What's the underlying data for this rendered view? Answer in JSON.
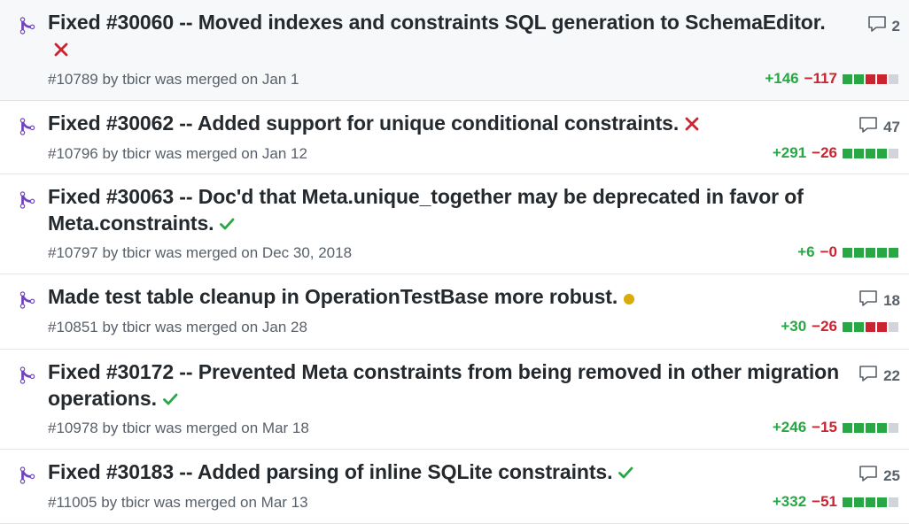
{
  "colors": {
    "added": "#28a745",
    "deleted": "#cb2431",
    "neutral": "#d1d5da",
    "pending": "#dbab09",
    "merged": "#6f42c1"
  },
  "pull_requests": [
    {
      "title": "Fixed #30060 -- Moved indexes and constraints SQL generation to SchemaEditor.",
      "status": "failure",
      "meta": "#10789 by tbicr was merged on Jan 1",
      "comments": "2",
      "additions": "+146",
      "deletions": "−117",
      "diff_blocks": [
        "added",
        "added",
        "deleted",
        "deleted",
        "neutral"
      ]
    },
    {
      "title": "Fixed #30062 -- Added support for unique conditional constraints.",
      "status": "failure",
      "meta": "#10796 by tbicr was merged on Jan 12",
      "comments": "47",
      "additions": "+291",
      "deletions": "−26",
      "diff_blocks": [
        "added",
        "added",
        "added",
        "added",
        "neutral"
      ]
    },
    {
      "title": "Fixed #30063 -- Doc'd that Meta.unique_together may be deprecated in favor of Meta.constraints.",
      "status": "success",
      "meta": "#10797 by tbicr was merged on Dec 30, 2018",
      "comments": "",
      "additions": "+6",
      "deletions": "−0",
      "diff_blocks": [
        "added",
        "added",
        "added",
        "added",
        "added"
      ]
    },
    {
      "title": "Made test table cleanup in OperationTestBase more robust.",
      "status": "pending",
      "meta": "#10851 by tbicr was merged on Jan 28",
      "comments": "18",
      "additions": "+30",
      "deletions": "−26",
      "diff_blocks": [
        "added",
        "added",
        "deleted",
        "deleted",
        "neutral"
      ]
    },
    {
      "title": "Fixed #30172 -- Prevented Meta constraints from being removed in other migration operations.",
      "status": "success",
      "meta": "#10978 by tbicr was merged on Mar 18",
      "comments": "22",
      "additions": "+246",
      "deletions": "−15",
      "diff_blocks": [
        "added",
        "added",
        "added",
        "added",
        "neutral"
      ]
    },
    {
      "title": "Fixed #30183 -- Added parsing of inline SQLite constraints.",
      "status": "success",
      "meta": "#11005 by tbicr was merged on Mar 13",
      "comments": "25",
      "additions": "+332",
      "deletions": "−51",
      "diff_blocks": [
        "added",
        "added",
        "added",
        "added",
        "neutral"
      ]
    }
  ]
}
